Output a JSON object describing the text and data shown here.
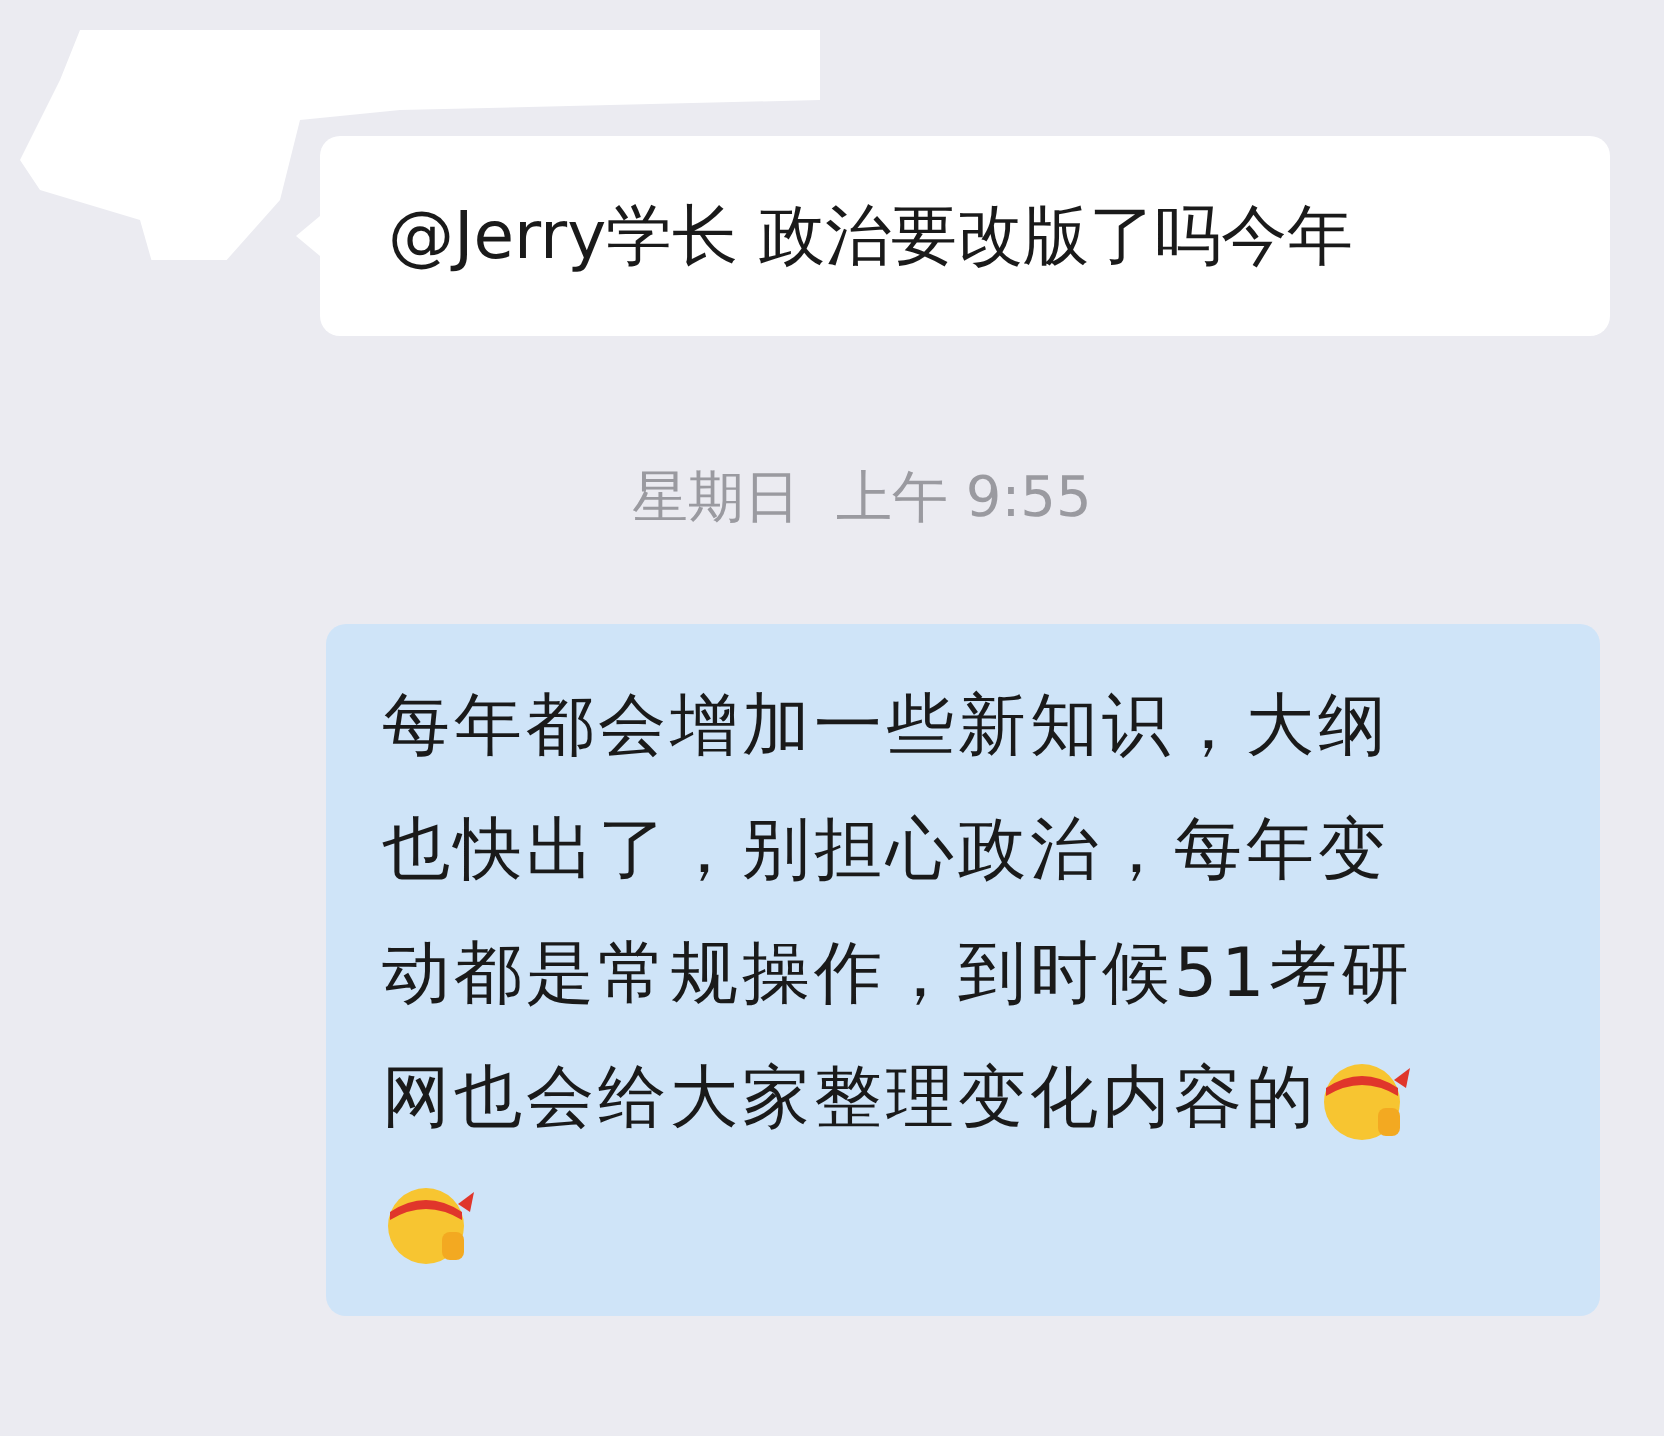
{
  "messages": [
    {
      "kind": "incoming",
      "text": "@Jerry学长 政治要改版了吗今年"
    },
    {
      "kind": "timestamp",
      "text": "星期日  上午 9:55"
    },
    {
      "kind": "outgoing",
      "lines": [
        "每年都会增加一些新知识，大纲",
        "也快出了，别担心政治，每年变",
        "动都是常规操作，到时候51考研",
        "网也会给大家整理变化内容的"
      ]
    }
  ]
}
